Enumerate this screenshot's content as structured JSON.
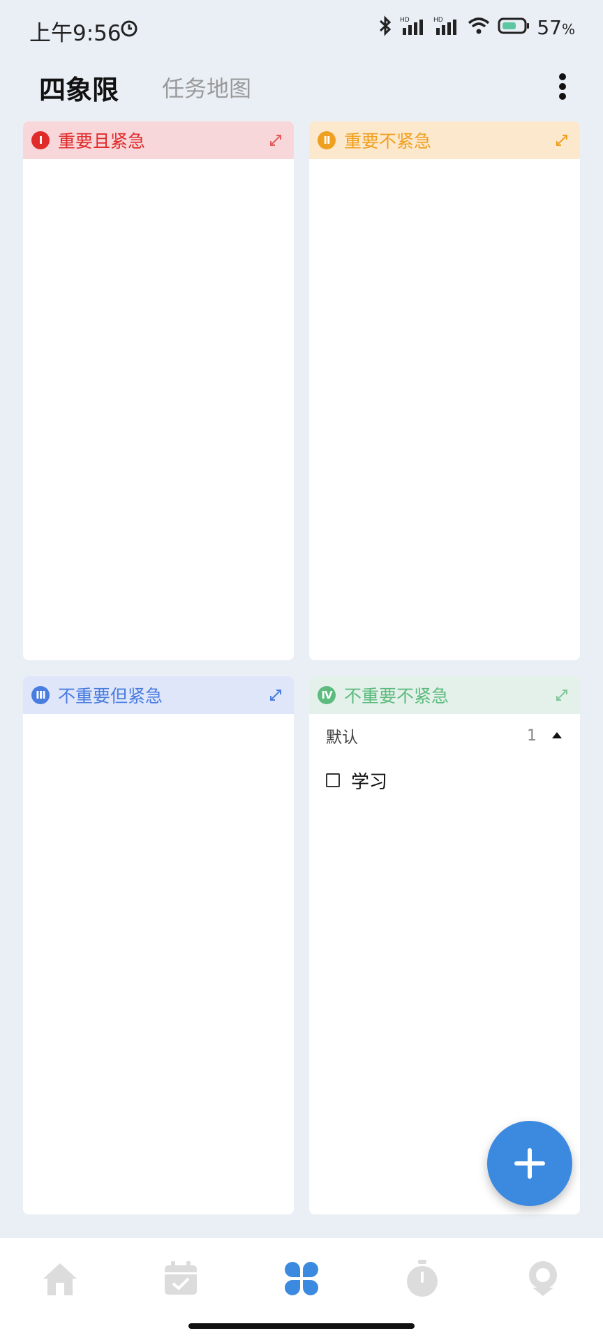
{
  "status_bar": {
    "time": "上午9:56",
    "battery_percent": "57",
    "battery_unit": "%",
    "icons": [
      "alarm-icon",
      "bluetooth-icon",
      "signal-hd-icon",
      "signal-hd-icon",
      "wifi-icon",
      "battery-icon"
    ]
  },
  "header": {
    "tabs": [
      {
        "label": "四象限",
        "active": true
      },
      {
        "label": "任务地图",
        "active": false
      }
    ]
  },
  "quadrants": [
    {
      "numeral": "I",
      "title": "重要且紧急",
      "color": "#e02b2b",
      "header_bg": "#f8d7da"
    },
    {
      "numeral": "II",
      "title": "重要不紧急",
      "color": "#f0a020",
      "header_bg": "#fce8cd"
    },
    {
      "numeral": "III",
      "title": "不重要但紧急",
      "color": "#4a7de0",
      "header_bg": "#dfe6fa"
    },
    {
      "numeral": "IV",
      "title": "不重要不紧急",
      "color": "#5dbb7e",
      "header_bg": "#e4f1ea",
      "groups": [
        {
          "name": "默认",
          "count": "1",
          "tasks": [
            {
              "title": "学习",
              "done": false
            }
          ]
        }
      ]
    }
  ],
  "fab": {
    "icon": "plus-icon",
    "color": "#3c8ae0"
  },
  "bottom_nav": {
    "items": [
      {
        "icon": "home-icon",
        "active": false
      },
      {
        "icon": "calendar-check-icon",
        "active": false
      },
      {
        "icon": "four-quadrant-icon",
        "active": true
      },
      {
        "icon": "timer-icon",
        "active": false
      },
      {
        "icon": "profile-icon",
        "active": false
      }
    ],
    "active_color": "#3c8ae0",
    "inactive_color": "#dcdcdc"
  }
}
